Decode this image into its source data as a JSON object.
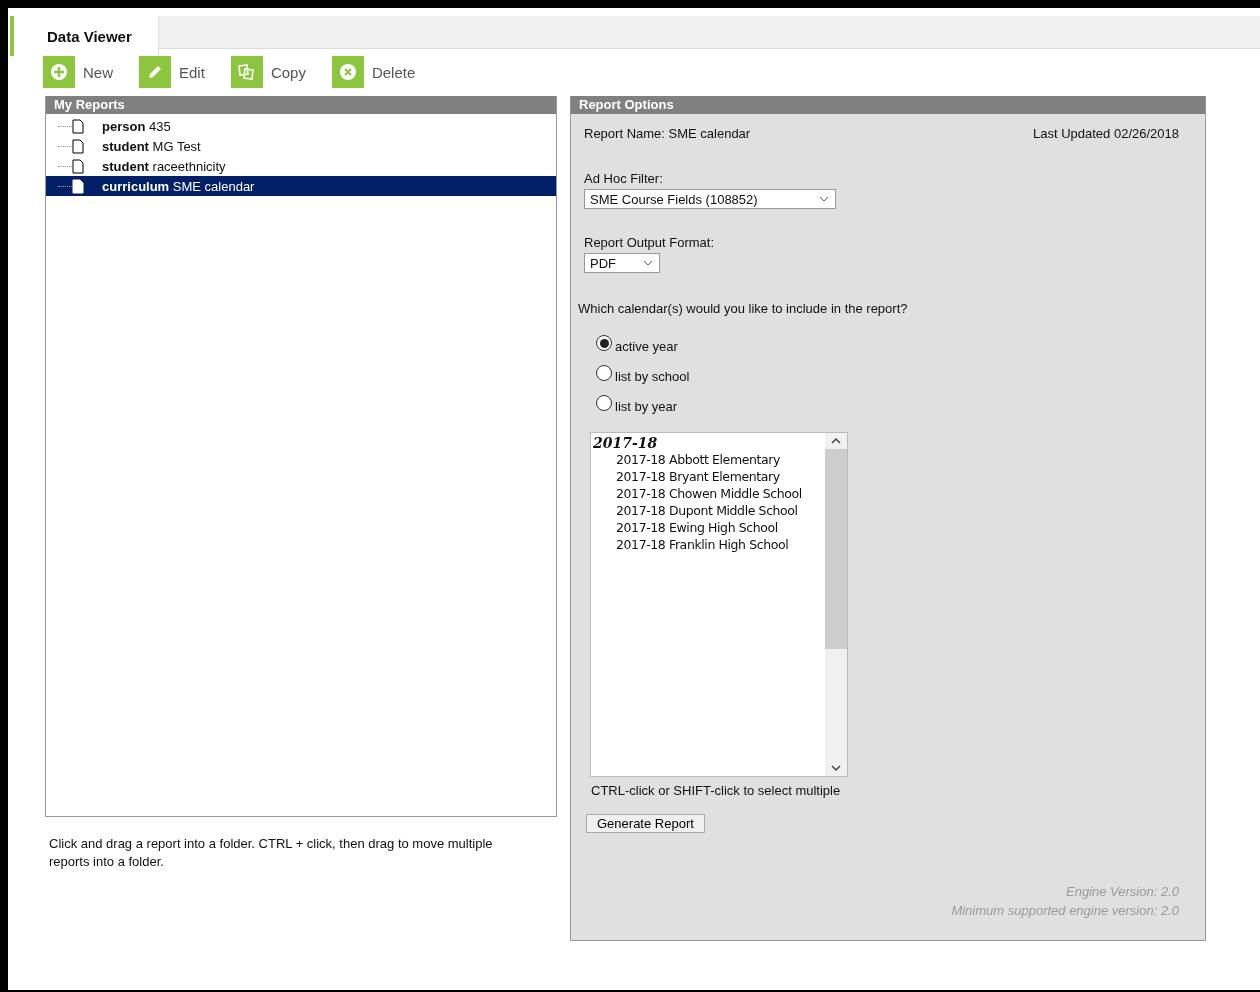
{
  "tabs": [
    {
      "label": "Data Viewer",
      "selected": true
    }
  ],
  "toolbar": [
    {
      "kind": "new",
      "label": "New"
    },
    {
      "kind": "edit",
      "label": "Edit"
    },
    {
      "kind": "copy",
      "label": "Copy"
    },
    {
      "kind": "delete",
      "label": "Delete"
    }
  ],
  "my_reports": {
    "title": "My Reports",
    "items": [
      {
        "type": "person",
        "name": "435",
        "selected": false
      },
      {
        "type": "student",
        "name": "MG Test",
        "selected": false
      },
      {
        "type": "student",
        "name": "raceethnicity",
        "selected": false
      },
      {
        "type": "curriculum",
        "name": "SME calendar",
        "selected": true
      }
    ],
    "help": "Click and drag a report into a folder. CTRL + click, then drag to move multiple reports into a folder."
  },
  "report_options": {
    "title": "Report Options",
    "report_name": "Report Name: SME calendar",
    "last_updated": "Last Updated 02/26/2018",
    "ad_hoc_filter": {
      "label": "Ad Hoc Filter:",
      "value": "SME Course Fields (108852)"
    },
    "output_format": {
      "label": "Report Output Format:",
      "value": "PDF"
    },
    "calendar_question": "Which calendar(s) would you like to include in the report?",
    "calendar_options": [
      {
        "label": "active year",
        "selected": true
      },
      {
        "label": "list by school",
        "selected": false
      },
      {
        "label": "list by year",
        "selected": false
      }
    ],
    "calendar_list": {
      "group": "2017-18",
      "items": [
        {
          "label": "2017-18 Abbott Elementary",
          "selected": false
        },
        {
          "label": "2017-18 Bryant Elementary",
          "selected": false
        },
        {
          "label": "2017-18 Chowen Middle School",
          "selected": false
        },
        {
          "label": "2017-18 Dupont Middle School",
          "selected": false
        },
        {
          "label": "2017-18 Ewing High School",
          "selected": false
        },
        {
          "label": "2017-18 Franklin High School",
          "selected": false
        }
      ]
    },
    "list_hint": "CTRL-click or SHIFT-click to select multiple",
    "generate_button": "Generate Report",
    "engine_version": "Engine Version: 2.0",
    "minimum_engine_version": "Minimum supported engine version: 2.0"
  }
}
